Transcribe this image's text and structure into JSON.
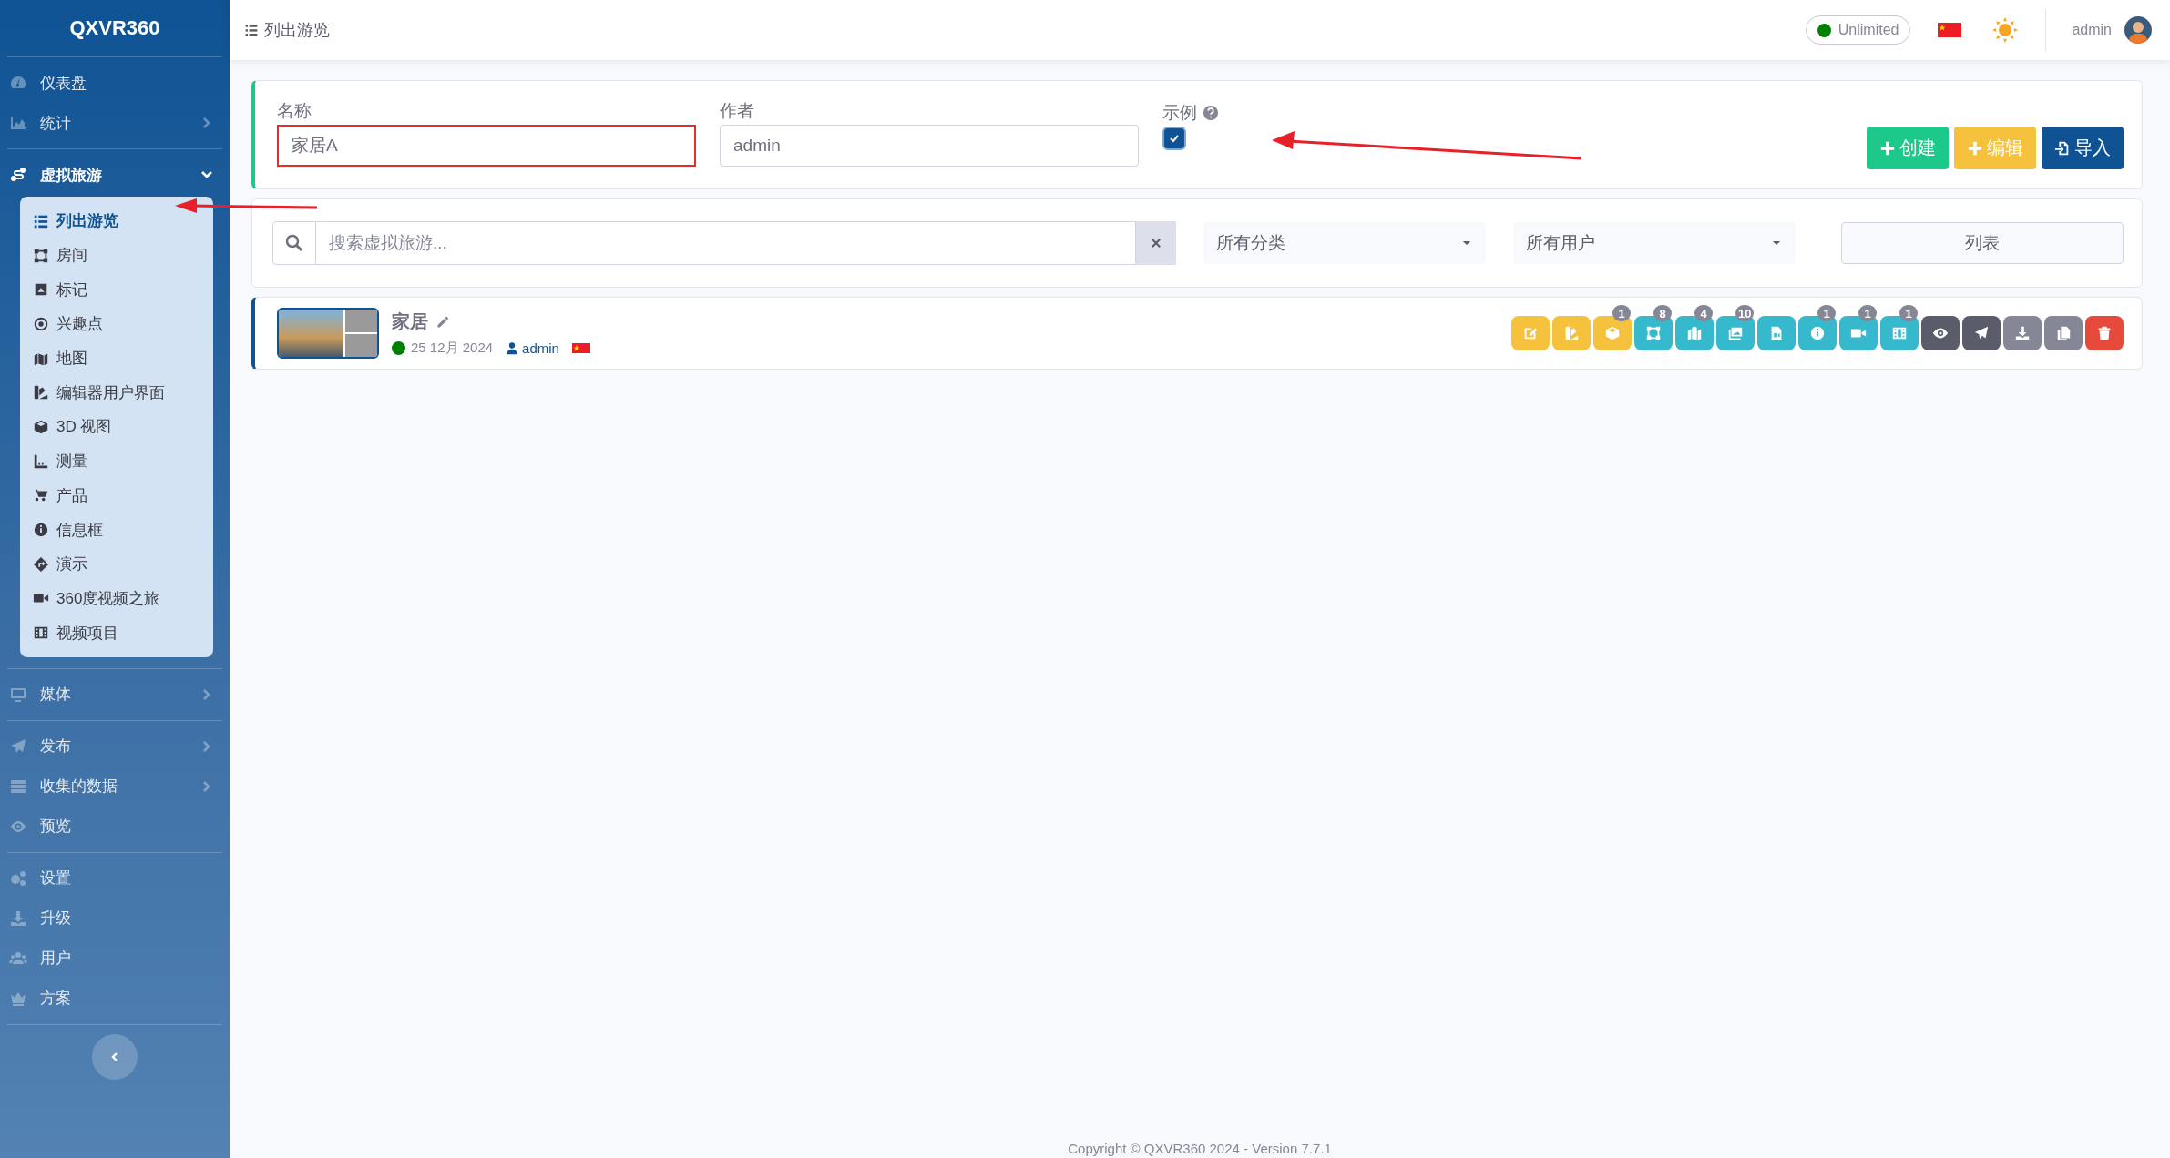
{
  "sidebar": {
    "brand": "QXVR360",
    "sections": [
      [
        {
          "label": "仪表盘",
          "kind": "link"
        },
        {
          "label": "统计",
          "kind": "group",
          "expanded": false
        }
      ],
      [
        {
          "label": "虚拟旅游",
          "kind": "group",
          "expanded": true,
          "children": [
            {
              "label": "列出游览",
              "selected": true
            },
            {
              "label": "房间",
              "selected": false
            },
            {
              "label": "标记",
              "selected": false
            },
            {
              "label": "兴趣点",
              "selected": false
            },
            {
              "label": "地图",
              "selected": false
            },
            {
              "label": "编辑器用户界面",
              "selected": false
            },
            {
              "label": "3D 视图",
              "selected": false
            },
            {
              "label": "测量",
              "selected": false
            },
            {
              "label": "产品",
              "selected": false
            },
            {
              "label": "信息框",
              "selected": false
            },
            {
              "label": "演示",
              "selected": false
            },
            {
              "label": "360度视频之旅",
              "selected": false
            },
            {
              "label": "视频项目",
              "selected": false
            }
          ]
        }
      ],
      [
        {
          "label": "媒体",
          "kind": "group",
          "expanded": false
        }
      ],
      [
        {
          "label": "发布",
          "kind": "group",
          "expanded": false
        },
        {
          "label": "收集的数据",
          "kind": "group",
          "expanded": false
        },
        {
          "label": "预览",
          "kind": "link"
        }
      ],
      [
        {
          "label": "设置",
          "kind": "link"
        },
        {
          "label": "升级",
          "kind": "link"
        },
        {
          "label": "用户",
          "kind": "link"
        },
        {
          "label": "方案",
          "kind": "link"
        }
      ]
    ]
  },
  "topbar": {
    "page_title": "列出游览",
    "plan": {
      "label": "Unlimited",
      "color": "#008000"
    },
    "user": "admin"
  },
  "filter": {
    "fields": [
      {
        "label": "名称",
        "value": "家居A",
        "invalid": true
      },
      {
        "label": "作者",
        "value": "admin",
        "invalid": false
      }
    ],
    "example": {
      "label": "示例",
      "checked": true
    },
    "buttons": [
      {
        "label": "创建",
        "kind": "create"
      },
      {
        "label": "编辑",
        "kind": "edit"
      },
      {
        "label": "导入",
        "kind": "import"
      }
    ]
  },
  "search": {
    "placeholder": "搜索虚拟旅游...",
    "category": "所有分类",
    "user": "所有用户",
    "view": "列表"
  },
  "tours": [
    {
      "title": "家居",
      "color": "#008000",
      "date": "25 12月 2024",
      "author": "admin",
      "actions": [
        {
          "kind": "edit",
          "color": "#f6c23e"
        },
        {
          "kind": "palette",
          "color": "#f6c23e"
        },
        {
          "kind": "cube",
          "color": "#f6c23e",
          "badge": "1"
        },
        {
          "kind": "rooms",
          "color": "#36b9cc",
          "badge": "8"
        },
        {
          "kind": "map",
          "color": "#36b9cc",
          "badge": "4"
        },
        {
          "kind": "gallery",
          "color": "#36b9cc",
          "badge": "10"
        },
        {
          "kind": "file-video",
          "color": "#36b9cc"
        },
        {
          "kind": "info",
          "color": "#36b9cc",
          "badge": "1"
        },
        {
          "kind": "video",
          "color": "#36b9cc",
          "badge": "1"
        },
        {
          "kind": "film",
          "color": "#36b9cc",
          "badge": "1"
        },
        {
          "kind": "preview",
          "color": "#5a5c69"
        },
        {
          "kind": "publish",
          "color": "#5a5c69"
        },
        {
          "kind": "download",
          "color": "#858796"
        },
        {
          "kind": "copy",
          "color": "#858796"
        },
        {
          "kind": "delete",
          "color": "#e74a3b"
        }
      ]
    }
  ],
  "footer": "Copyright © QXVR360 2024 - Version 7.7.1"
}
